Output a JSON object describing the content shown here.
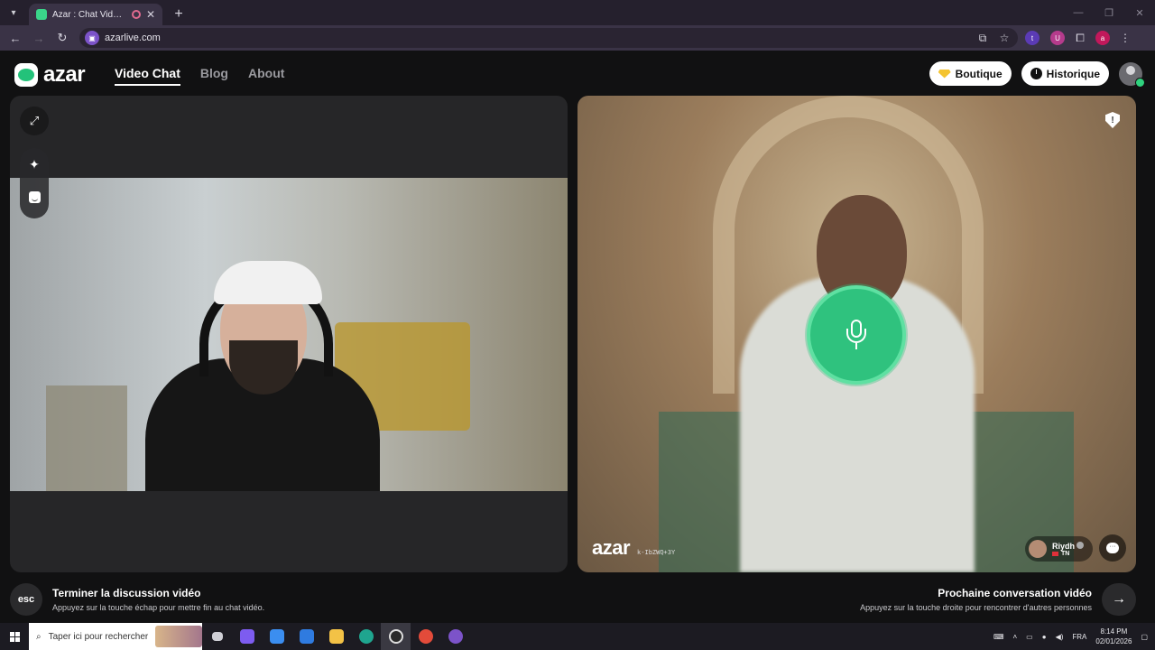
{
  "browser": {
    "tab_title": "Azar : Chat Vidéo avec de n",
    "tab_close": "✕",
    "new_tab": "+",
    "url": "azarlive.com",
    "extensions": [
      {
        "label": "t",
        "color": "#5b3bb5"
      },
      {
        "label": "U",
        "color": "#b53b8c"
      },
      {
        "label": "a",
        "color": "#c2185b"
      }
    ]
  },
  "site": {
    "logo_text": "azar",
    "nav": [
      {
        "label": "Video Chat",
        "active": true
      },
      {
        "label": "Blog",
        "active": false
      },
      {
        "label": "About",
        "active": false
      }
    ],
    "boutique_label": "Boutique",
    "historique_label": "Historique"
  },
  "remote": {
    "watermark": "azar",
    "session_id": "k-IbZWQ+3Y",
    "peer_name": "Riydh",
    "peer_country": "TN"
  },
  "controls": {
    "esc_label": "esc",
    "end_title": "Terminer la discussion vidéo",
    "end_sub": "Appuyez sur la touche échap pour mettre fin au chat vidéo.",
    "next_title": "Prochaine conversation vidéo",
    "next_sub": "Appuyez sur la touche droite pour rencontrer d'autres personnes",
    "next_arrow": "→"
  },
  "taskbar": {
    "search_placeholder": "Taper ici pour rechercher",
    "language": "FRA",
    "time": "8:14 PM",
    "date": "02/01/2026",
    "apps": [
      {
        "name": "task-view",
        "color": "#cfcfd6"
      },
      {
        "name": "copilot",
        "color": "#7d5cf0"
      },
      {
        "name": "store",
        "color": "#3b8ef0"
      },
      {
        "name": "mail",
        "color": "#2f7be0"
      },
      {
        "name": "explorer",
        "color": "#f3c246"
      },
      {
        "name": "edge",
        "color": "#1fa58f"
      },
      {
        "name": "obs",
        "color": "#2a2a2a"
      },
      {
        "name": "chrome",
        "color": "#e34b3a"
      },
      {
        "name": "chrome-profile",
        "color": "#7c53c9"
      }
    ]
  },
  "colors": {
    "accent_green": "#2fc27e",
    "background": "#111112"
  }
}
